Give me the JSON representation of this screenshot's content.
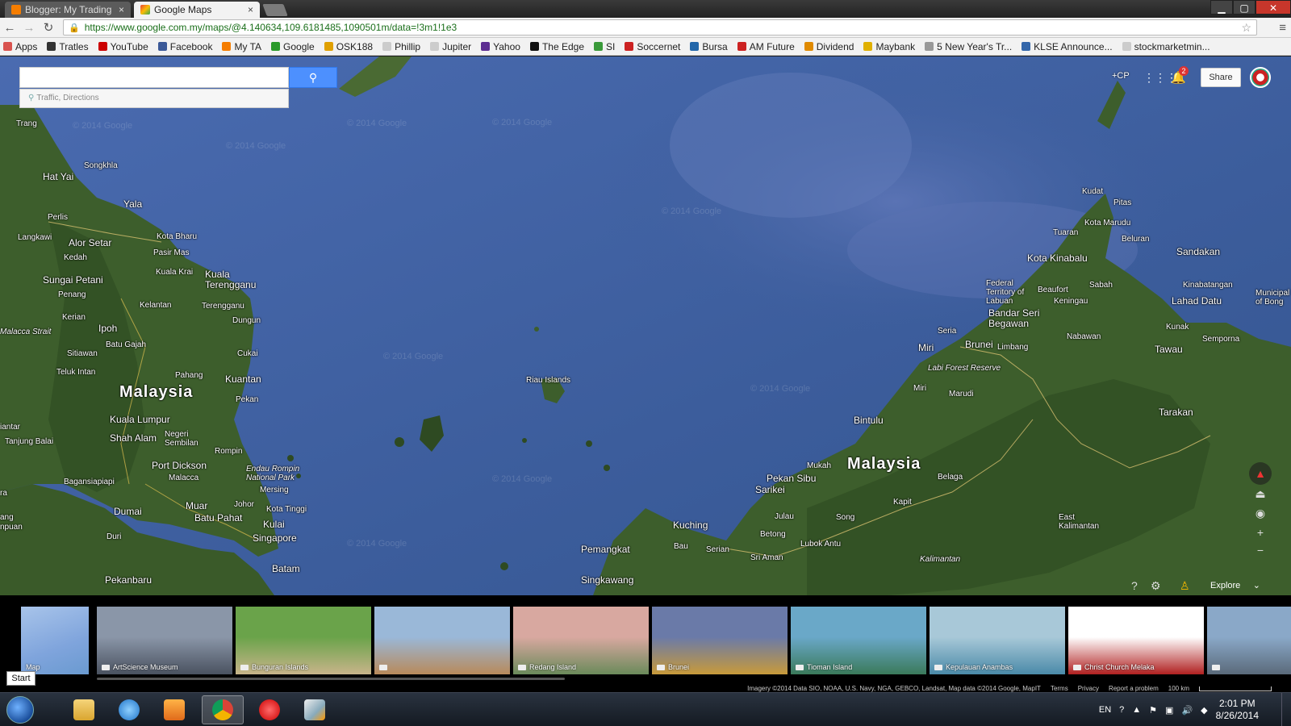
{
  "browser": {
    "tabs": [
      {
        "label": "Blogger: My Trading",
        "active": false,
        "color": "#f57d00"
      },
      {
        "label": "Google Maps",
        "active": true,
        "color": "#34a853"
      }
    ],
    "url": "https://www.google.com.my/maps/@4.140634,109.6181485,1090501m/data=!3m1!1e3",
    "bookmarks": [
      {
        "label": "Apps",
        "color": "#d9534f"
      },
      {
        "label": "Tratles",
        "color": "#333333"
      },
      {
        "label": "YouTube",
        "color": "#cc0000"
      },
      {
        "label": "Facebook",
        "color": "#3b5998"
      },
      {
        "label": "My TA",
        "color": "#f57d00"
      },
      {
        "label": "Google",
        "color": "#2a9a2a"
      },
      {
        "label": "OSK188",
        "color": "#e0a000"
      },
      {
        "label": "Phillip",
        "color": "#cccccc"
      },
      {
        "label": "Jupiter",
        "color": "#cccccc"
      },
      {
        "label": "Yahoo",
        "color": "#5c2d91"
      },
      {
        "label": "The Edge",
        "color": "#111111"
      },
      {
        "label": "SI",
        "color": "#3a9a3a"
      },
      {
        "label": "Soccernet",
        "color": "#cc2222"
      },
      {
        "label": "Bursa",
        "color": "#2266aa"
      },
      {
        "label": "AM Future",
        "color": "#cc2222"
      },
      {
        "label": "Dividend",
        "color": "#e08a00"
      },
      {
        "label": "Maybank",
        "color": "#e0b000"
      },
      {
        "label": "5 New Year's Tr...",
        "color": "#999999"
      },
      {
        "label": "KLSE Announce...",
        "color": "#3366aa"
      },
      {
        "label": "stockmarketmin...",
        "color": "#cccccc"
      }
    ]
  },
  "search": {
    "placeholder": "",
    "button_icon": "search-icon",
    "sub_label": "Traffic, Directions"
  },
  "topright": {
    "user": "+CP",
    "notifications": "2",
    "share_label": "Share"
  },
  "map_labels": {
    "malaysia_west": "Malaysia",
    "malaysia_east": "Malaysia",
    "trang": "Trang",
    "songkhla": "Songkhla",
    "hat_yai": "Hat Yai",
    "yala": "Yala",
    "langkawi": "Langkawi",
    "perlis": "Perlis",
    "alor_setar": "Alor Setar",
    "kedah": "Kedah",
    "kota_bharu": "Kota Bharu",
    "pasir_mas": "Pasir Mas",
    "kuala_krai": "Kuala Krai",
    "sungai_petani": "Sungai Petani",
    "penang": "Penang",
    "kuala_terengganu": "Kuala Terengganu",
    "kelantan": "Kelantan",
    "terengganu": "Terengganu",
    "dungun": "Dungun",
    "kerian": "Kerian",
    "ipoh": "Ipoh",
    "malacca_strait": "Malacca Strait",
    "batu_gajah": "Batu Gajah",
    "sitiawan": "Sitiawan",
    "cukai": "Cukai",
    "teluk_intan": "Teluk Intan",
    "pahang": "Pahang",
    "kuantan": "Kuantan",
    "pekan": "Pekan",
    "kuala_lumpur": "Kuala Lumpur",
    "shah_alam": "Shah Alam",
    "negeri_sembilan": "Negeri Sembilan",
    "rompin": "Rompin",
    "tanjung_balai": "Tanjung Balai",
    "port_dickson": "Port Dickson",
    "endau_rompin": "Endau Rompin National Park",
    "malacca": "Malacca",
    "bagansiapiapi": "Bagansiapiapi",
    "mersing": "Mersing",
    "muar": "Muar",
    "johor": "Johor",
    "dumai": "Dumai",
    "batu_pahat": "Batu Pahat",
    "kota_tinggi": "Kota Tinggi",
    "kulai": "Kulai",
    "singapore": "Singapore",
    "duri": "Duri",
    "batam": "Batam",
    "pekanbaru": "Pekanbaru",
    "riau_islands": "Riau Islands",
    "kudat": "Kudat",
    "pitas": "Pitas",
    "kota_marudu": "Kota Marudu",
    "tuaran": "Tuaran",
    "beluran": "Beluran",
    "sandakan": "Sandakan",
    "kota_kinabalu": "Kota Kinabalu",
    "federal_territory": "Federal Territory of Labuan",
    "beaufort": "Beaufort",
    "sabah": "Sabah",
    "keningau": "Keningau",
    "kinabatangan": "Kinabatangan",
    "lahad_datu": "Lahad Datu",
    "bandar_seri_begawan": "Bandar Seri Begawan",
    "seria": "Seria",
    "miri_city": "Miri",
    "brunei": "Brunei",
    "limbang": "Limbang",
    "labi_forest": "Labi Forest Reserve",
    "nabawan": "Nabawan",
    "kunak": "Kunak",
    "tawau": "Tawau",
    "semporna": "Semporna",
    "miri_district": "Miri",
    "marudi": "Marudi",
    "bintulu": "Bintulu",
    "tarakan": "Tarakan",
    "mukah": "Mukah",
    "pekan_sibu": "Pekan Sibu",
    "sarikei": "Sarikei",
    "belaga": "Belaga",
    "kapit": "Kapit",
    "julau": "Julau",
    "song": "Song",
    "kuching": "Kuching",
    "pemangkat": "Pemangkat",
    "bau": "Bau",
    "serian": "Serian",
    "betong": "Betong",
    "lubok_antu": "Lubok Antu",
    "sri_aman": "Sri Aman",
    "east_kalimantan": "East Kalimantan",
    "kalimantan": "Kalimantan",
    "singkawang": "Singkawang",
    "municipality": "Municipal of Bong",
    "lingga": "ang",
    "lingga2": "npuan",
    "ra": "ra",
    "iantar": "iantar",
    "watermark": "© 2014 Google"
  },
  "map_controls": {
    "explore_label": "Explore"
  },
  "filmstrip": {
    "items": [
      {
        "caption": "Map",
        "kind": "map"
      },
      {
        "caption": "ArtScience Museum",
        "kind": "photo",
        "c1": "#8a96a8",
        "c2": "#4a5260"
      },
      {
        "caption": "Bunguran Islands",
        "kind": "photo",
        "c1": "#6aa34a",
        "c2": "#c8b48a"
      },
      {
        "caption": "",
        "kind": "photo",
        "c1": "#9ab8d8",
        "c2": "#b88a5a"
      },
      {
        "caption": "Redang Island",
        "kind": "photo",
        "c1": "#d8a8a0",
        "c2": "#6a8a5a"
      },
      {
        "caption": "Brunei",
        "kind": "photo",
        "c1": "#6a7aa8",
        "c2": "#c89a3a"
      },
      {
        "caption": "Tioman Island",
        "kind": "photo",
        "c1": "#6aa8c8",
        "c2": "#3a7a5a"
      },
      {
        "caption": "Kepulauan Anambas",
        "kind": "photo",
        "c1": "#a8c8d8",
        "c2": "#4a8aa8"
      },
      {
        "caption": "Christ Church Melaka",
        "kind": "photo",
        "c1": "#ffffff",
        "c2": "#b02020"
      },
      {
        "caption": "",
        "kind": "photo",
        "c1": "#8aa8c8",
        "c2": "#5a6a7a"
      }
    ],
    "start_label": "Start"
  },
  "footer": {
    "attribution": "Imagery ©2014 Data SIO, NOAA, U.S. Navy, NGA, GEBCO, Landsat, Map data ©2014 Google, MapIT",
    "terms": "Terms",
    "privacy": "Privacy",
    "report": "Report a problem",
    "scale": "100 km"
  },
  "taskbar": {
    "language": "EN",
    "time": "2:01 PM",
    "date": "8/26/2014"
  },
  "colors": {
    "sea": "#3e5f9d",
    "land": "#3a5a2c"
  }
}
